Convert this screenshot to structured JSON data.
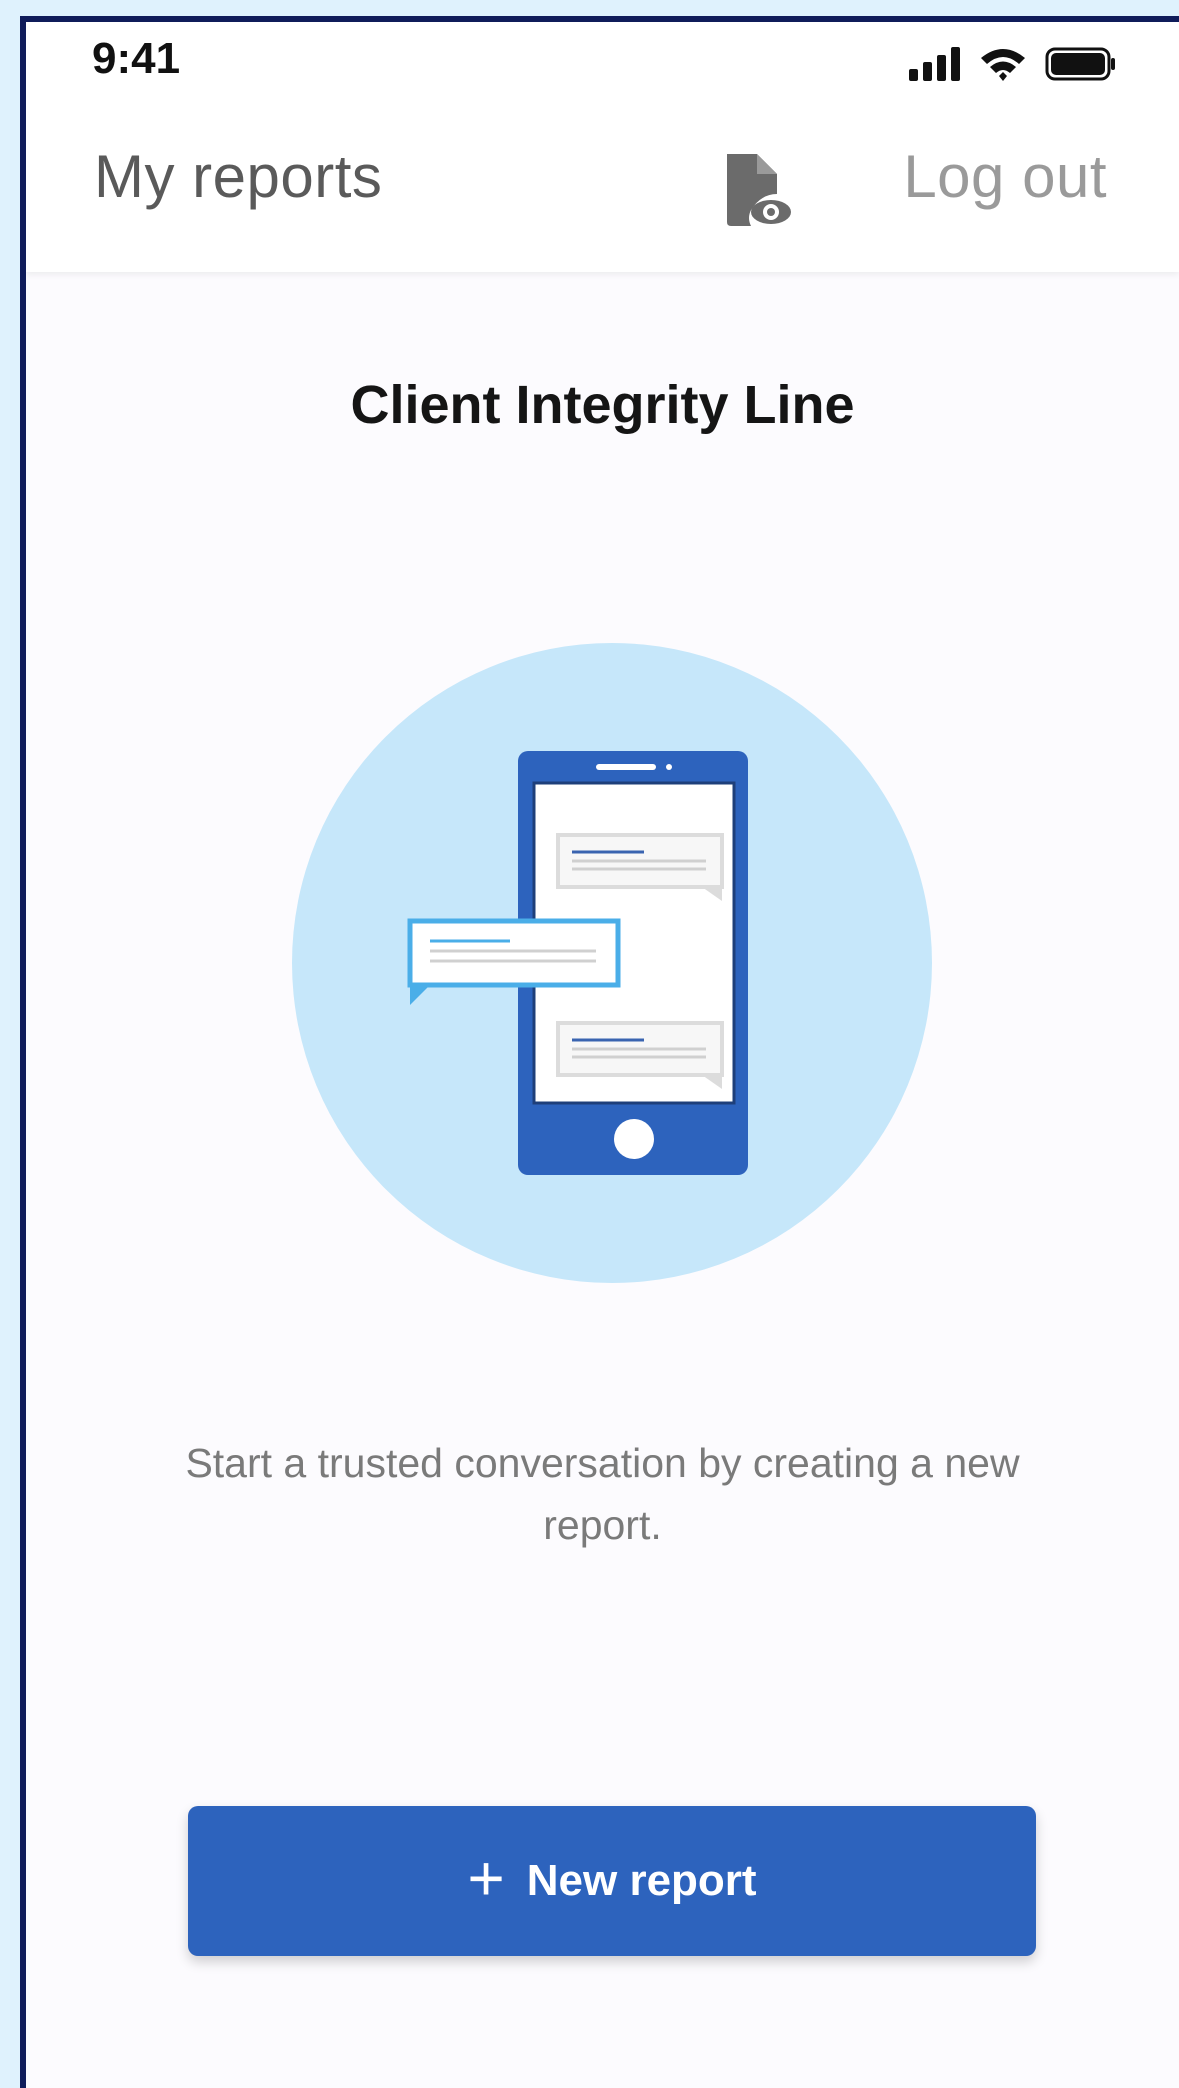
{
  "status_bar": {
    "time": "9:41",
    "icons": [
      "signal-icon",
      "wifi-icon",
      "battery-icon"
    ]
  },
  "nav": {
    "title": "My reports",
    "report_icon": "document-eye-icon",
    "logout_label": "Log out"
  },
  "main": {
    "title": "Client Integrity Line",
    "illustration": "phone-chat-illustration",
    "message": "Start a trusted conversation by creating a new report.",
    "button": {
      "icon": "plus-icon",
      "label": "New report"
    }
  },
  "colors": {
    "accent": "#2d63bd",
    "illustration_circle": "#c6e7fa",
    "frame_border": "#0f1c5a",
    "background": "#dff2fd"
  }
}
